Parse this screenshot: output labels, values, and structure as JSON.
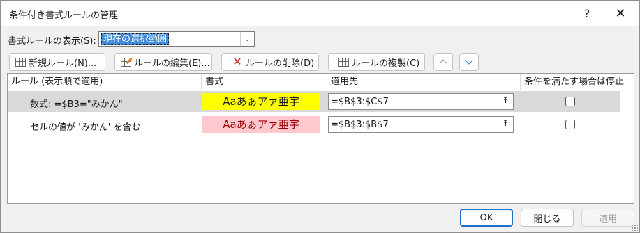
{
  "window": {
    "title": "条件付き書式ルールの管理",
    "help": "?",
    "close": "✕"
  },
  "show_rules": {
    "label": "書式ルールの表示(S):",
    "selected": "現在の選択範囲"
  },
  "toolbar": {
    "new_rule": "新規ルール(N)...",
    "edit_rule": "ルールの編集(E)...",
    "delete_rule": "ルールの削除(D)",
    "duplicate_rule": "ルールの複製(C)"
  },
  "table": {
    "headers": {
      "rule": "ルール (表示順で適用)",
      "format": "書式",
      "applies_to": "適用先",
      "stop_if_true": "条件を満たす場合は停止"
    },
    "rows": [
      {
        "rule": "数式: =$B3=\"みかん\"",
        "preview": "Aaあぁアァ亜宇",
        "preview_bg": "#ffff00",
        "preview_fg": "#1a1a1a",
        "applies_to": "=$B$3:$C$7",
        "stop": false
      },
      {
        "rule": "セルの値が 'みかん' を含む",
        "preview": "Aaあぁアァ亜宇",
        "preview_bg": "#ffc7ce",
        "preview_fg": "#9c0006",
        "applies_to": "=$B$3:$B$7",
        "stop": false
      }
    ]
  },
  "footer": {
    "ok": "OK",
    "close": "閉じる",
    "apply": "適用"
  }
}
